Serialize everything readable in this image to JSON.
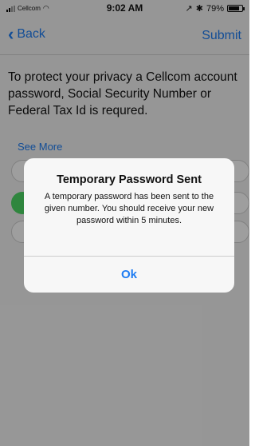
{
  "status_bar": {
    "carrier": "Cellcom",
    "time": "9:02 AM",
    "battery_level": "79%",
    "battery_fraction": 0.79,
    "wifi_icon": "wifi-icon",
    "bluetooth_icon": "bluetooth-icon",
    "location_icon": "location-icon"
  },
  "nav": {
    "back_label": "Back",
    "submit_label": "Submit",
    "accent_color": "#1e7cf2"
  },
  "content": {
    "info_text": "To protect your privacy a Cellcom account password, Social Security Number or Federal Tax Id is requred.",
    "see_more_label": "See More",
    "selected_color": "#4cd964"
  },
  "alert": {
    "title": "Temporary Password Sent",
    "message": "A temporary password has been sent to the given number. You should receive your new password within 5 minutes.",
    "ok_label": "Ok"
  }
}
